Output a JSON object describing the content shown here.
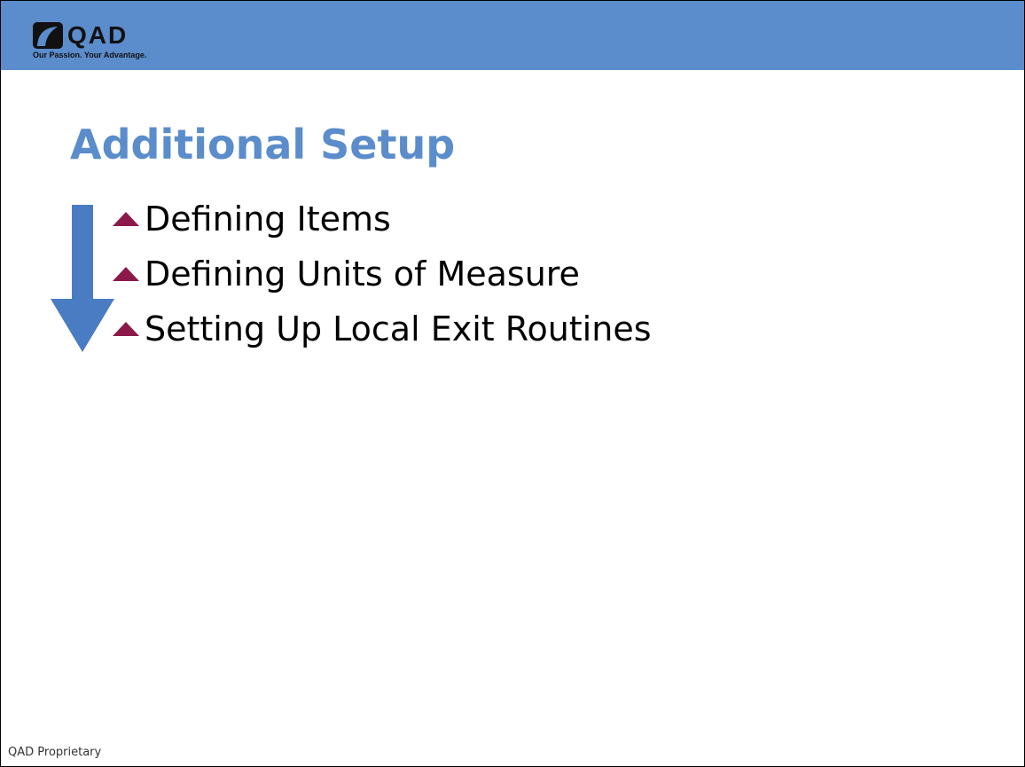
{
  "header": {
    "logo_text": "QAD",
    "tagline": "Our Passion. Your Advantage."
  },
  "title": "Additional Setup",
  "bullets": [
    {
      "label": "Defining Items"
    },
    {
      "label": "Defining Units of Measure"
    },
    {
      "label": "Setting Up Local Exit Routines"
    }
  ],
  "footer": {
    "text": "QAD Proprietary"
  },
  "colors": {
    "header_band": "#5b8ccb",
    "title": "#5b8ccb",
    "arrow": "#4a7cc4",
    "bullet_marker": "#8b1a4a"
  },
  "icons": {
    "logo": "qad-logo-icon",
    "flow_arrow": "down-arrow-icon",
    "bullet": "triangle-up-icon"
  }
}
